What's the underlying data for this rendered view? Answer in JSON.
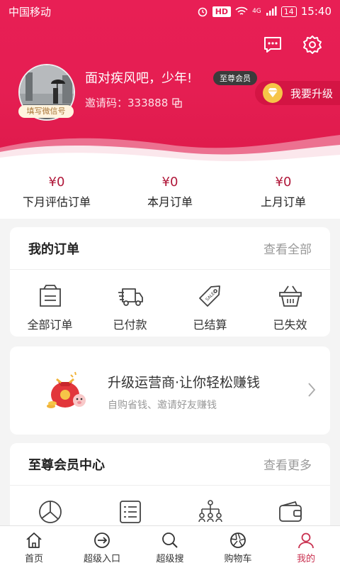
{
  "status": {
    "carrier": "中国移动",
    "hd": "HD",
    "signal": "4G",
    "battery": "14",
    "time": "15:40"
  },
  "profile": {
    "nickname": "面对疾风吧，少年!",
    "vip_badge": "至尊会员",
    "invite": "邀请码：333888",
    "wechat_tag": "填写微信号",
    "upgrade_label": "我要升级"
  },
  "stats": [
    {
      "value": "¥0",
      "label": "下月评估订单"
    },
    {
      "value": "¥0",
      "label": "本月订单"
    },
    {
      "value": "¥0",
      "label": "上月订单"
    }
  ],
  "orders": {
    "title": "我的订单",
    "more": "查看全部",
    "items": [
      {
        "label": "全部订单",
        "icon": "order-list-icon"
      },
      {
        "label": "已付款",
        "icon": "truck-icon"
      },
      {
        "label": "已结算",
        "icon": "sale-tag-icon"
      },
      {
        "label": "已失效",
        "icon": "basket-icon"
      }
    ]
  },
  "promo": {
    "title": "升级运营商·让你轻松赚钱",
    "subtitle": "自购省钱、邀请好友赚钱"
  },
  "vip_center": {
    "title": "至尊会员中心",
    "more": "查看更多",
    "icons": [
      "pie-chart-icon",
      "list-icon",
      "org-chart-icon",
      "wallet-icon"
    ]
  },
  "nav": [
    {
      "label": "首页",
      "icon": "home-icon"
    },
    {
      "label": "超级入口",
      "icon": "enter-icon"
    },
    {
      "label": "超级搜",
      "icon": "search-icon"
    },
    {
      "label": "购物车",
      "icon": "shutter-icon"
    },
    {
      "label": "我的",
      "icon": "user-icon",
      "active": true
    }
  ],
  "colors": {
    "brand": "#e81f55",
    "price": "#b0183a",
    "active_nav": "#c9304f"
  }
}
